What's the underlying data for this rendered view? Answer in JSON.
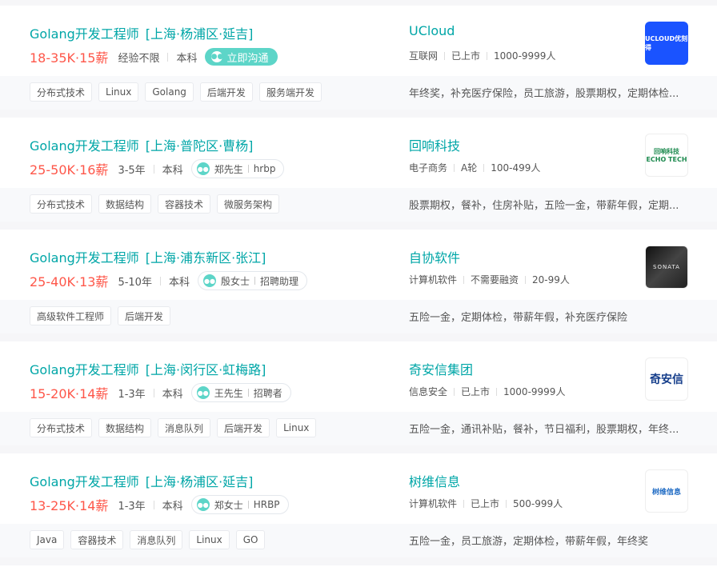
{
  "jobs": [
    {
      "title": "Golang开发工程师",
      "location": "[上海·杨浦区·延吉]",
      "salary": "18-35K·15薪",
      "experience": "经验不限",
      "education": "本科",
      "chat_button": "立即沟通",
      "tags": [
        "分布式技术",
        "Linux",
        "Golang",
        "后端开发",
        "服务端开发"
      ],
      "company": "UCloud",
      "industry": "互联网",
      "stage": "已上市",
      "size": "1000-9999人",
      "benefits": "年终奖，补充医疗保险，员工旅游，股票期权，定期体检...",
      "logo_text": "UCLOUD优刻得"
    },
    {
      "title": "Golang开发工程师",
      "location": "[上海·普陀区·曹杨]",
      "salary": "25-50K·16薪",
      "experience": "3-5年",
      "education": "本科",
      "recruiter_name": "郑先生",
      "recruiter_role": "hrbp",
      "tags": [
        "分布式技术",
        "数据结构",
        "容器技术",
        "微服务架构"
      ],
      "company": "回响科技",
      "industry": "电子商务",
      "stage": "A轮",
      "size": "100-499人",
      "benefits": "股票期权，餐补，住房补贴，五险一金，带薪年假，定期...",
      "logo_text": "回响科技",
      "logo_sub": "ECHO TECH"
    },
    {
      "title": "Golang开发工程师",
      "location": "[上海·浦东新区·张江]",
      "salary": "25-40K·13薪",
      "experience": "5-10年",
      "education": "本科",
      "recruiter_name": "殷女士",
      "recruiter_role": "招聘助理",
      "tags": [
        "高级软件工程师",
        "后端开发"
      ],
      "company": "自协软件",
      "industry": "计算机软件",
      "stage": "不需要融资",
      "size": "20-99人",
      "benefits": "五险一金，定期体检，带薪年假，补充医疗保险",
      "logo_text": "SONATA"
    },
    {
      "title": "Golang开发工程师",
      "location": "[上海·闵行区·虹梅路]",
      "salary": "15-20K·14薪",
      "experience": "1-3年",
      "education": "本科",
      "recruiter_name": "王先生",
      "recruiter_role": "招聘者",
      "tags": [
        "分布式技术",
        "数据结构",
        "消息队列",
        "后端开发",
        "Linux"
      ],
      "company": "奇安信集团",
      "industry": "信息安全",
      "stage": "已上市",
      "size": "1000-9999人",
      "benefits": "五险一金，通讯补贴，餐补，节日福利，股票期权，年终...",
      "logo_text": "奇安信"
    },
    {
      "title": "Golang开发工程师",
      "location": "[上海·杨浦区·延吉]",
      "salary": "13-25K·14薪",
      "experience": "1-3年",
      "education": "本科",
      "recruiter_name": "郑女士",
      "recruiter_role": "HRBP",
      "tags": [
        "Java",
        "容器技术",
        "消息队列",
        "Linux",
        "GO"
      ],
      "company": "树维信息",
      "industry": "计算机软件",
      "stage": "已上市",
      "size": "500-999人",
      "benefits": "五险一金，员工旅游，定期体检，带薪年假，年终奖",
      "logo_text": "树维信息"
    }
  ],
  "colors": {
    "accent": "#00a6a7",
    "salary": "#fe574a",
    "chat": "#5dd5c8"
  }
}
